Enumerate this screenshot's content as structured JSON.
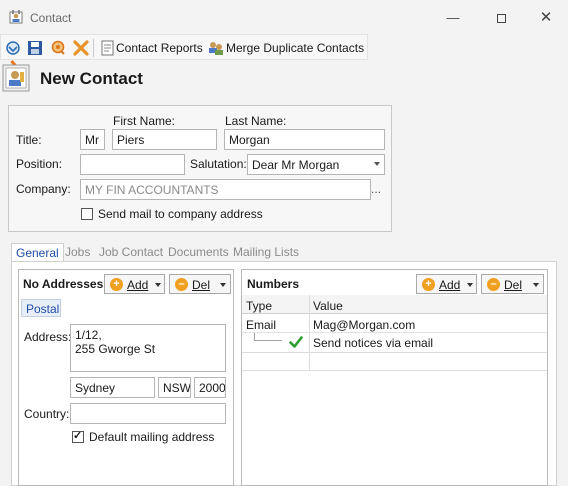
{
  "window": {
    "title": "Contact"
  },
  "toolbar": {
    "contact_reports": "Contact Reports",
    "merge_duplicates": "Merge Duplicate Contacts"
  },
  "header": {
    "title": "New Contact"
  },
  "form": {
    "first_name_label": "First Name:",
    "last_name_label": "Last Name:",
    "title_label": "Title:",
    "title_value": "Mr",
    "first_name_value": "Piers",
    "last_name_value": "Morgan",
    "position_label": "Position:",
    "position_value": "",
    "salutation_label": "Salutation:",
    "salutation_value": "Dear Mr Morgan",
    "company_label": "Company:",
    "company_value": "MY FIN ACCOUNTANTS",
    "company_ellipsis": "...",
    "send_mail_label": "Send mail to company address",
    "send_mail_checked": false
  },
  "tabs": [
    {
      "label": "General",
      "active": true
    },
    {
      "label": "Jobs",
      "active": false
    },
    {
      "label": "Job Contact",
      "active": false
    },
    {
      "label": "Documents",
      "active": false
    },
    {
      "label": "Mailing Lists",
      "active": false
    }
  ],
  "addresses": {
    "title": "No Addresses",
    "add_label": "Add",
    "del_label": "Del",
    "tab_postal": "Postal",
    "address_label": "Address:",
    "address_line1": "1/12,",
    "address_line2": "255 Gworge St",
    "city": "Sydney",
    "state": "NSW",
    "postcode": "2000",
    "country_label": "Country:",
    "country_value": "",
    "default_mailing_label": "Default mailing address",
    "default_mailing_checked": true
  },
  "numbers": {
    "title": "Numbers",
    "add_label": "Add",
    "del_label": "Del",
    "col_type": "Type",
    "col_value": "Value",
    "rows": [
      {
        "type": "Email",
        "value": "Mag@Morgan.com"
      }
    ],
    "sub_option": "Send notices via email"
  },
  "colors": {
    "accent": "#1f4ea8",
    "pen": "#e87722",
    "orange_button": "#f0a020",
    "check_green": "#2e9d2e"
  }
}
